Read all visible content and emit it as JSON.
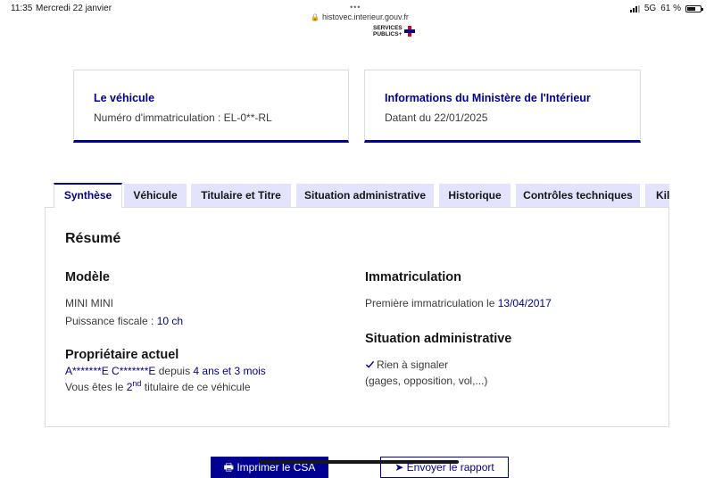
{
  "status_bar": {
    "time": "11:35",
    "date": "Mercredi 22 janvier",
    "url": "histovec.interieur.gouv.fr",
    "network": "5G",
    "battery": "61 %",
    "battery_level": 0.61
  },
  "logo": {
    "line1": "SERVICES",
    "line2": "PUBLICS"
  },
  "vehicle_card": {
    "title": "Le véhicule",
    "plate_text": "Numéro d'immatriculation : EL-0**-RL"
  },
  "ministry_card": {
    "title": "Informations du Ministère de l'Intérieur",
    "date_text": "Datant du 22/01/2025"
  },
  "tabs": [
    {
      "label": "Synthèse",
      "active": true
    },
    {
      "label": "Véhicule"
    },
    {
      "label": "Titulaire et Titre"
    },
    {
      "label": "Situation administrative"
    },
    {
      "label": "Historique"
    },
    {
      "label": "Contrôles techniques"
    },
    {
      "label": "Kilo"
    }
  ],
  "summary": {
    "title": "Résumé",
    "model": {
      "heading": "Modèle",
      "name": "MINI MINI",
      "power_label": "Puissance fiscale : ",
      "power_value": "10 ch"
    },
    "owner": {
      "heading": "Propriétaire actuel",
      "name": "A*******E C*******E",
      "since_label": " depuis ",
      "since_value": "4 ans et 3 mois",
      "rank_prefix": "Vous êtes le ",
      "rank_num": "2",
      "rank_sup": "nd",
      "rank_suffix": " titulaire de ce véhicule"
    },
    "registration": {
      "heading": "Immatriculation",
      "first_label": "Première immatriculation le ",
      "first_date": "13/04/2017"
    },
    "admin": {
      "heading": "Situation administrative",
      "status": "Rien à signaler",
      "detail": "(gages, opposition, vol,...)"
    }
  },
  "actions": {
    "print_label": "Imprimer le CSA",
    "send_label": "Envoyer le rapport"
  }
}
